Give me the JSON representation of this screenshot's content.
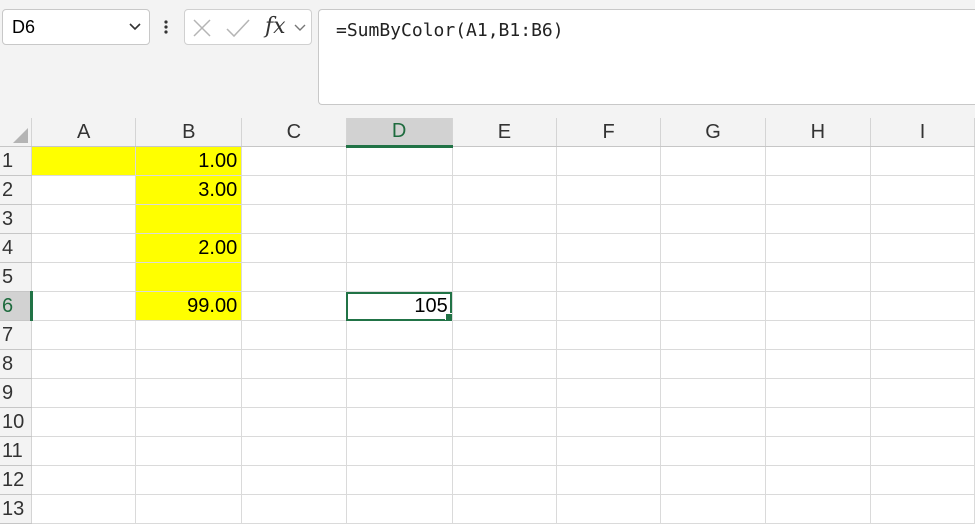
{
  "name_box": {
    "value": "D6"
  },
  "formula_bar": {
    "fx_label": "fx",
    "formula": "=SumByColor(A1,B1:B6)"
  },
  "colors": {
    "highlight": "#ffff00",
    "accent": "#217346"
  },
  "columns": [
    "A",
    "B",
    "C",
    "D",
    "E",
    "F",
    "G",
    "H",
    "I"
  ],
  "selected_column": "D",
  "selected_row": "6",
  "rows": [
    {
      "header": "1",
      "cells": [
        "",
        "1.00",
        "",
        "",
        "",
        "",
        "",
        "",
        ""
      ]
    },
    {
      "header": "2",
      "cells": [
        "",
        "3.00",
        "",
        "",
        "",
        "",
        "",
        "",
        ""
      ]
    },
    {
      "header": "3",
      "cells": [
        "",
        "",
        "",
        "",
        "",
        "",
        "",
        "",
        ""
      ]
    },
    {
      "header": "4",
      "cells": [
        "",
        "2.00",
        "",
        "",
        "",
        "",
        "",
        "",
        ""
      ]
    },
    {
      "header": "5",
      "cells": [
        "",
        "",
        "",
        "",
        "",
        "",
        "",
        "",
        ""
      ]
    },
    {
      "header": "6",
      "cells": [
        "",
        "99.00",
        "",
        "105",
        "",
        "",
        "",
        "",
        ""
      ]
    },
    {
      "header": "7",
      "cells": [
        "",
        "",
        "",
        "",
        "",
        "",
        "",
        "",
        ""
      ]
    },
    {
      "header": "8",
      "cells": [
        "",
        "",
        "",
        "",
        "",
        "",
        "",
        "",
        ""
      ]
    },
    {
      "header": "9",
      "cells": [
        "",
        "",
        "",
        "",
        "",
        "",
        "",
        "",
        ""
      ]
    },
    {
      "header": "10",
      "cells": [
        "",
        "",
        "",
        "",
        "",
        "",
        "",
        "",
        ""
      ]
    },
    {
      "header": "11",
      "cells": [
        "",
        "",
        "",
        "",
        "",
        "",
        "",
        "",
        ""
      ]
    },
    {
      "header": "12",
      "cells": [
        "",
        "",
        "",
        "",
        "",
        "",
        "",
        "",
        ""
      ]
    },
    {
      "header": "13",
      "cells": [
        "",
        "",
        "",
        "",
        "",
        "",
        "",
        "",
        ""
      ]
    }
  ],
  "highlighted_cells": [
    "A1",
    "B1",
    "B2",
    "B3",
    "B4",
    "B5",
    "B6"
  ],
  "active_cell": "D6"
}
